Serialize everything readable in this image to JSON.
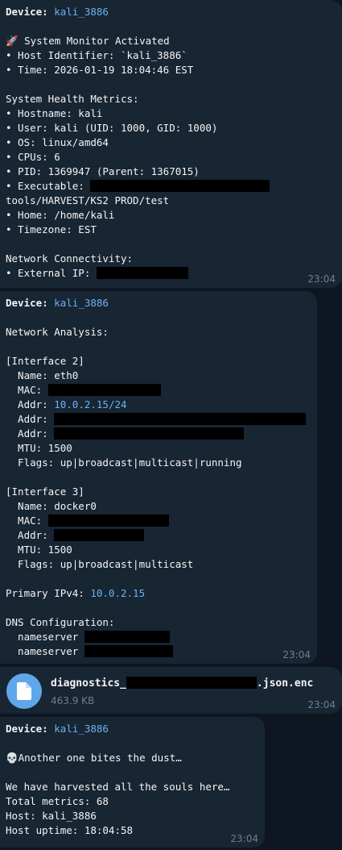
{
  "msg1": {
    "device_label": "Device:",
    "device_name": "kali_3886",
    "header": "🚀 System Monitor Activated",
    "host_identifier": "• Host Identifier: `kali_3886`",
    "time_line": "• Time: 2026-01-19 18:04:46 EST",
    "health_title": "System Health Metrics:",
    "hostname": "• Hostname: kali",
    "user": "• User: kali (UID: 1000, GID: 1000)",
    "os": "• OS: linux/amd64",
    "cpus": "• CPUs: 6",
    "pid": "• PID: 1369947 (Parent: 1367015)",
    "executable_label": "• Executable: ",
    "executable_cont": "tools/HARVEST/KS2 PROD/test",
    "home": "• Home: /home/kali",
    "timezone": "• Timezone: EST",
    "network_title": "Network Connectivity:",
    "external_ip_label": "• External IP: ",
    "time": "23:04"
  },
  "msg2": {
    "device_label": "Device:",
    "device_name": "kali_3886",
    "title": "Network Analysis:",
    "iface2": {
      "header": "[Interface 2]",
      "name": "  Name: eth0",
      "mac_label": "  MAC: ",
      "addr_label": "  Addr: ",
      "addr_value": "10.0.2.15/24",
      "addr2_label": "  Addr: ",
      "addr3_label": "  Addr: ",
      "mtu": "  MTU: 1500",
      "flags": "  Flags: up|broadcast|multicast|running"
    },
    "iface3": {
      "header": "[Interface 3]",
      "name": "  Name: docker0",
      "mac_label": "  MAC: ",
      "addr_label": "  Addr: ",
      "mtu": "  MTU: 1500",
      "flags": "  Flags: up|broadcast|multicast"
    },
    "primary_label": "Primary IPv4: ",
    "primary_value": "10.0.2.15",
    "dns_title": "DNS Configuration:",
    "ns1_label": "  nameserver ",
    "ns2_label": "  nameserver ",
    "time": "23:04"
  },
  "msg3": {
    "filename_prefix": "diagnostics_",
    "filename_suffix": ".json.enc",
    "filesize": "463.9 KB",
    "time": "23:04"
  },
  "msg4": {
    "device_label": "Device:",
    "device_name": "kali_3886",
    "line1": "💀Another one bites the dust…",
    "line2": "We have harvested all the souls here…",
    "line3": "Total metrics: 68",
    "line4": "Host: kali_3886",
    "line5": "Host uptime: 18:04:58",
    "time": "23:04"
  },
  "colors": {
    "background": "#0e1621",
    "bubble": "#182533",
    "accent": "#6ab2f2",
    "file_icon": "#5fa7e8",
    "redaction": "#000000"
  },
  "icons": {
    "file": "document-icon"
  }
}
